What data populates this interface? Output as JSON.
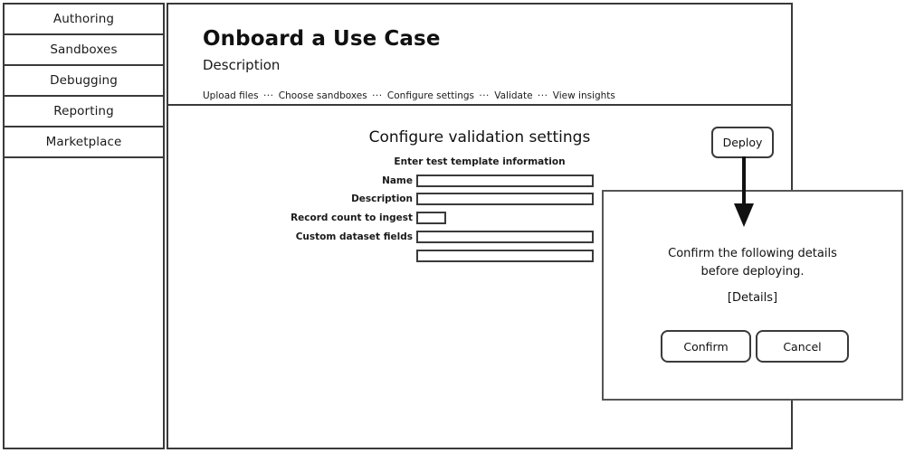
{
  "sidebar": {
    "items": [
      {
        "label": "Authoring"
      },
      {
        "label": "Sandboxes"
      },
      {
        "label": "Debugging"
      },
      {
        "label": "Reporting"
      },
      {
        "label": "Marketplace"
      }
    ]
  },
  "header": {
    "title": "Onboard a Use Case",
    "subtitle": "Description",
    "breadcrumb": {
      "separator": "···",
      "steps": [
        "Upload files",
        "Choose sandboxes",
        "Configure settings",
        "Validate",
        "View insights"
      ]
    }
  },
  "main": {
    "section_title": "Configure validation settings",
    "section_subtitle": "Enter test template information",
    "fields": [
      {
        "label": "Name",
        "value": "",
        "placeholder": "",
        "size": "wide"
      },
      {
        "label": "Description",
        "value": "",
        "placeholder": "",
        "size": "wide"
      },
      {
        "label": "Record count to ingest",
        "value": "",
        "placeholder": "",
        "size": "small"
      },
      {
        "label": "Custom dataset fields",
        "value": "",
        "placeholder": "",
        "size": "wide"
      },
      {
        "label": "",
        "value": "",
        "placeholder": "",
        "size": "wide"
      }
    ],
    "deploy_label": "Deploy"
  },
  "dialog": {
    "message_line1": "Confirm the following details",
    "message_line2": "before deploying.",
    "details_label": "[Details]",
    "confirm_label": "Confirm",
    "cancel_label": "Cancel"
  },
  "colors": {
    "stroke": "#3a3a3a",
    "dialog_stroke": "#555555",
    "text": "#111111",
    "background": "#ffffff"
  }
}
